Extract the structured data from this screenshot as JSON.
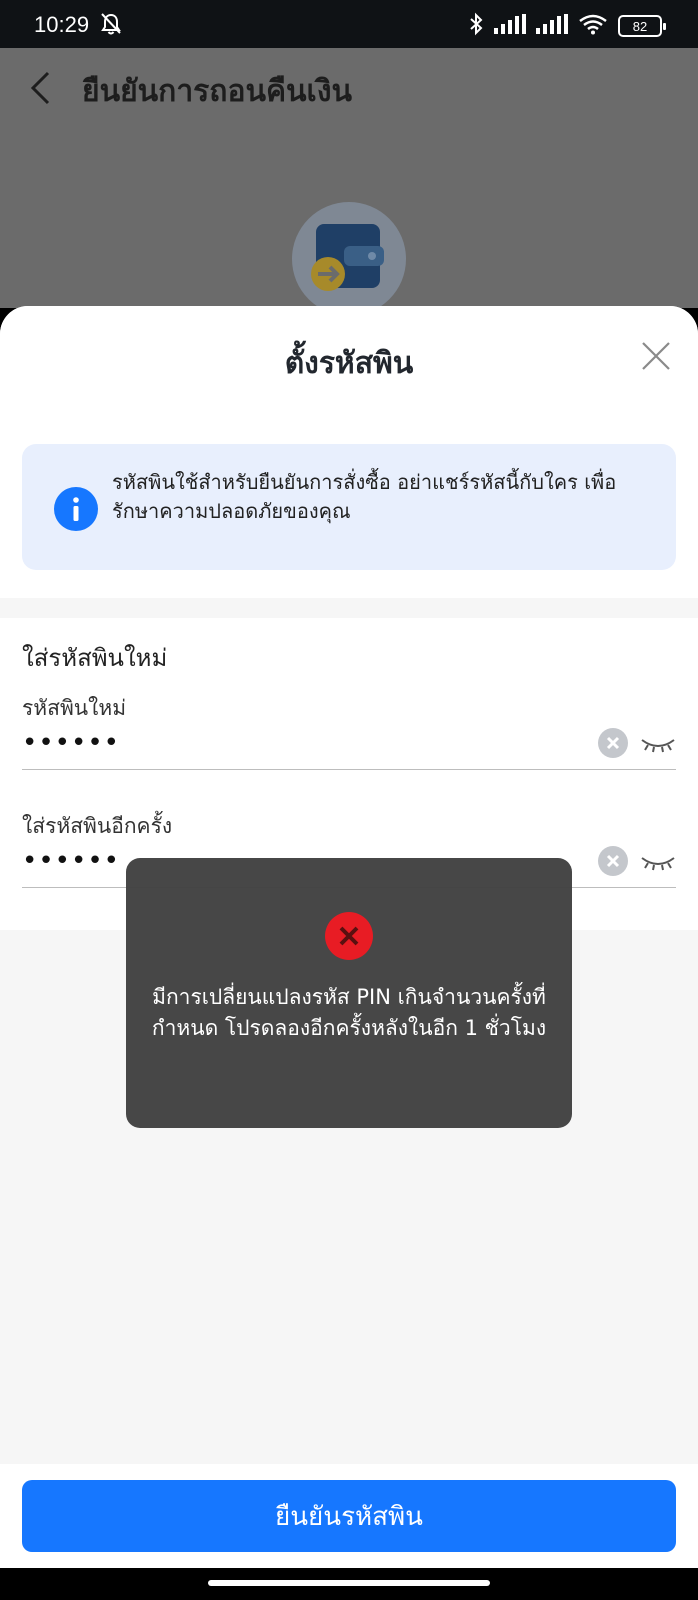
{
  "status_bar": {
    "time": "10:29",
    "battery": "82"
  },
  "page": {
    "title": "ยืนยันการถอนคืนเงิน"
  },
  "sheet": {
    "title": "ตั้งรหัสพิน",
    "info": "รหัสพินใช้สำหรับยืนยันการสั่งซื้อ อย่าแชร์รหัสนี้กับใคร เพื่อรักษาความปลอดภัยของคุณ",
    "form": {
      "heading": "ใส่รหัสพินใหม่",
      "new_pin_label": "รหัสพินใหม่",
      "new_pin_value": "••••••",
      "confirm_pin_label": "ใส่รหัสพินอีกครั้ง",
      "confirm_pin_value": "••••••"
    },
    "confirm_button": "ยืนยันรหัสพิน"
  },
  "toast": {
    "message": "มีการเปลี่ยนแปลงรหัส PIN เกินจำนวนครั้งที่กำหนด โปรดลองอีกครั้งหลังในอีก 1 ชั่วโมง"
  },
  "colors": {
    "primary": "#1677ff",
    "error": "#e81c24",
    "info_bg": "#e8effd"
  }
}
